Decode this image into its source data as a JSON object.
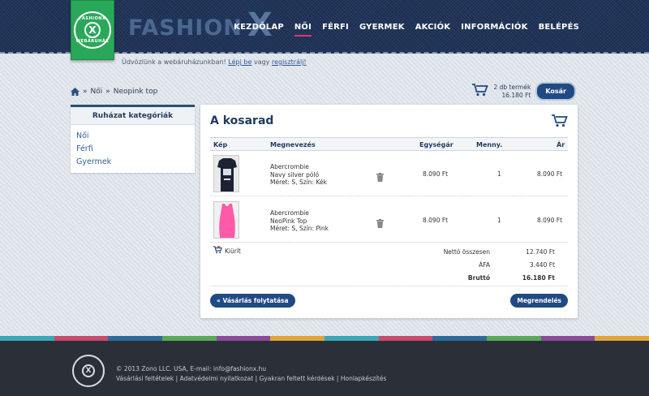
{
  "header": {
    "logo_top": "FASHIONX",
    "logo_bottom": "WEBÁRUHÁZ",
    "logo_letter": "X",
    "brand_text": "FASHION",
    "brand_x": "X",
    "nav": [
      {
        "label": "KEZDŐLAP",
        "active": false
      },
      {
        "label": "NŐI",
        "active": true
      },
      {
        "label": "FÉRFI",
        "active": false
      },
      {
        "label": "GYERMEK",
        "active": false
      },
      {
        "label": "AKCIÓK",
        "active": false
      },
      {
        "label": "INFORMÁCIÓK",
        "active": false
      },
      {
        "label": "BELÉPÉS",
        "active": false
      }
    ],
    "welcome": {
      "prefix": "Üdvözlünk a webáruházunkban!",
      "login": "Lépj be",
      "or": "vagy",
      "register": "regisztrálj!"
    }
  },
  "breadcrumb": {
    "sep": "»",
    "items": [
      "Női",
      "Neopink top"
    ]
  },
  "mini_cart": {
    "count": "2 db termék",
    "total": "16.180 Ft",
    "button": "Kosár"
  },
  "sidebar": {
    "title": "Ruházat kategóriák",
    "items": [
      "Női",
      "Férfi",
      "Gyermek"
    ]
  },
  "cart": {
    "title": "A kosarad",
    "columns": {
      "image": "Kép",
      "name": "Megnevezés",
      "unit_price": "Egységár",
      "qty": "Menny.",
      "price": "Ár"
    },
    "items": [
      {
        "brand": "Abercrombie",
        "name": "Navy silver póló",
        "spec": "Méret: S, Szín: Kék",
        "unit_price": "8.090 Ft",
        "qty": "1",
        "price": "8.090 Ft",
        "color": "#1b2233"
      },
      {
        "brand": "Abercrombie",
        "name": "NeoPink Top",
        "spec": "Méret: S, Szín: Pink",
        "unit_price": "8.090 Ft",
        "qty": "1",
        "price": "8.090 Ft",
        "color": "#ff5aa8"
      }
    ],
    "empty_label": "Kiürít",
    "net_label": "Nettó összesen",
    "net_value": "12.740 Ft",
    "vat_label": "ÁFA",
    "vat_value": "3.440 Ft",
    "gross_label": "Bruttó",
    "gross_value": "16.180 Ft",
    "continue_button": "« Vásárlás folytatása",
    "order_button": "Megrendelés"
  },
  "footer": {
    "copyright": "© 2013 Zono LLC. USA, E-mail: info@fashionx.hu",
    "links": [
      "Vásárlási feltételek",
      "Adatvédelmi nyilatkozat",
      "Gyakran feltett kérdések",
      "Honlapkészítés"
    ],
    "stripe_colors": [
      "#3aa7b8",
      "#c94a6b",
      "#2d6b9a",
      "#5aa85a",
      "#8a4a9a",
      "#e0a43a",
      "#3aa7b8",
      "#c94a6b",
      "#2d6b9a",
      "#5aa85a",
      "#8a4a9a",
      "#e0a43a"
    ]
  }
}
